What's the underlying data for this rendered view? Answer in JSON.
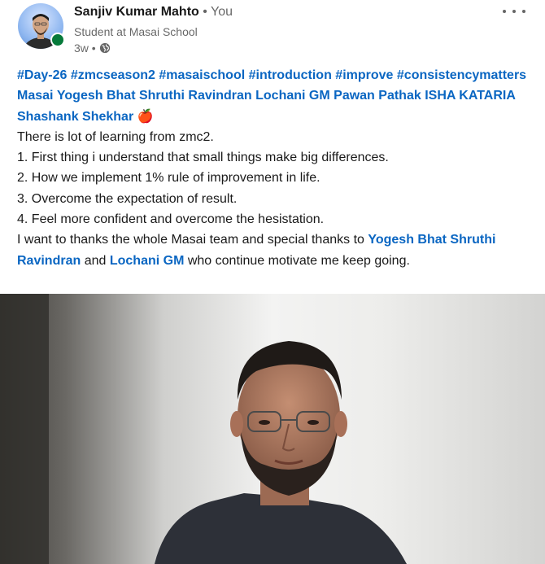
{
  "author": {
    "name": "Sanjiv Kumar Mahto",
    "relation": "• You",
    "headline": "Student at Masai School",
    "time": "3w •",
    "visibility_icon": "globe-icon",
    "status": "online"
  },
  "post": {
    "hashtags": [
      "#Day-26",
      "#zmcseason2",
      "#masaischool",
      "#introduction",
      "#improve",
      "#consistencymatters"
    ],
    "mentions": [
      "Masai",
      "Yogesh Bhat",
      "Shruthi Ravindran",
      "Lochani GM",
      "Pawan Pathak",
      "ISHA KATARIA",
      "Shashank Shekhar"
    ],
    "mention_emoji": "🍎",
    "lines": [
      "There is lot of learning from zmc2.",
      "1. First thing i understand that small things make big differences.",
      "2. How we implement 1% rule of improvement in life.",
      "3. Overcome the expectation of result.",
      "4. Feel more confident and overcome the hesistation."
    ],
    "closing": {
      "prefix": "I want to thanks the whole Masai team and special thanks to ",
      "mention_1": "Yogesh Bhat",
      "mention_2": "Shruthi Ravindran",
      "conjunction": " and ",
      "mention_3": "Lochani GM",
      "suffix": " who continue motivate me keep going."
    }
  },
  "colors": {
    "link": "#0a66c2",
    "text": "#000000e6",
    "muted": "#00000099",
    "online": "#067a3a"
  }
}
